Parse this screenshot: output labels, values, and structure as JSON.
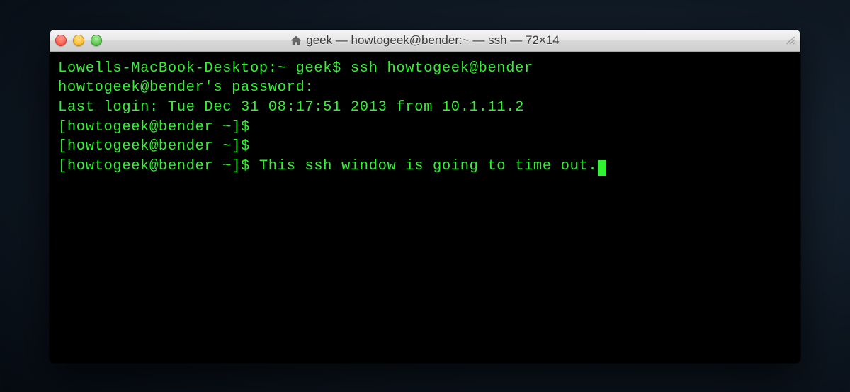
{
  "window": {
    "title": "geek — howtogeek@bender:~ — ssh — 72×14"
  },
  "terminal": {
    "lines": [
      {
        "prompt": "Lowells-MacBook-Desktop:~ geek$ ",
        "text": "ssh howtogeek@bender",
        "cursor": false
      },
      {
        "prompt": "",
        "text": "howtogeek@bender's password:",
        "cursor": false
      },
      {
        "prompt": "",
        "text": "Last login: Tue Dec 31 08:17:51 2013 from 10.1.11.2",
        "cursor": false
      },
      {
        "prompt": "[howtogeek@bender ~]$ ",
        "text": "",
        "cursor": false
      },
      {
        "prompt": "[howtogeek@bender ~]$ ",
        "text": "",
        "cursor": false
      },
      {
        "prompt": "[howtogeek@bender ~]$ ",
        "text": "This ssh window is going to time out.",
        "cursor": true
      }
    ]
  },
  "colors": {
    "term_fg": "#32f032",
    "term_bg": "#000000"
  }
}
